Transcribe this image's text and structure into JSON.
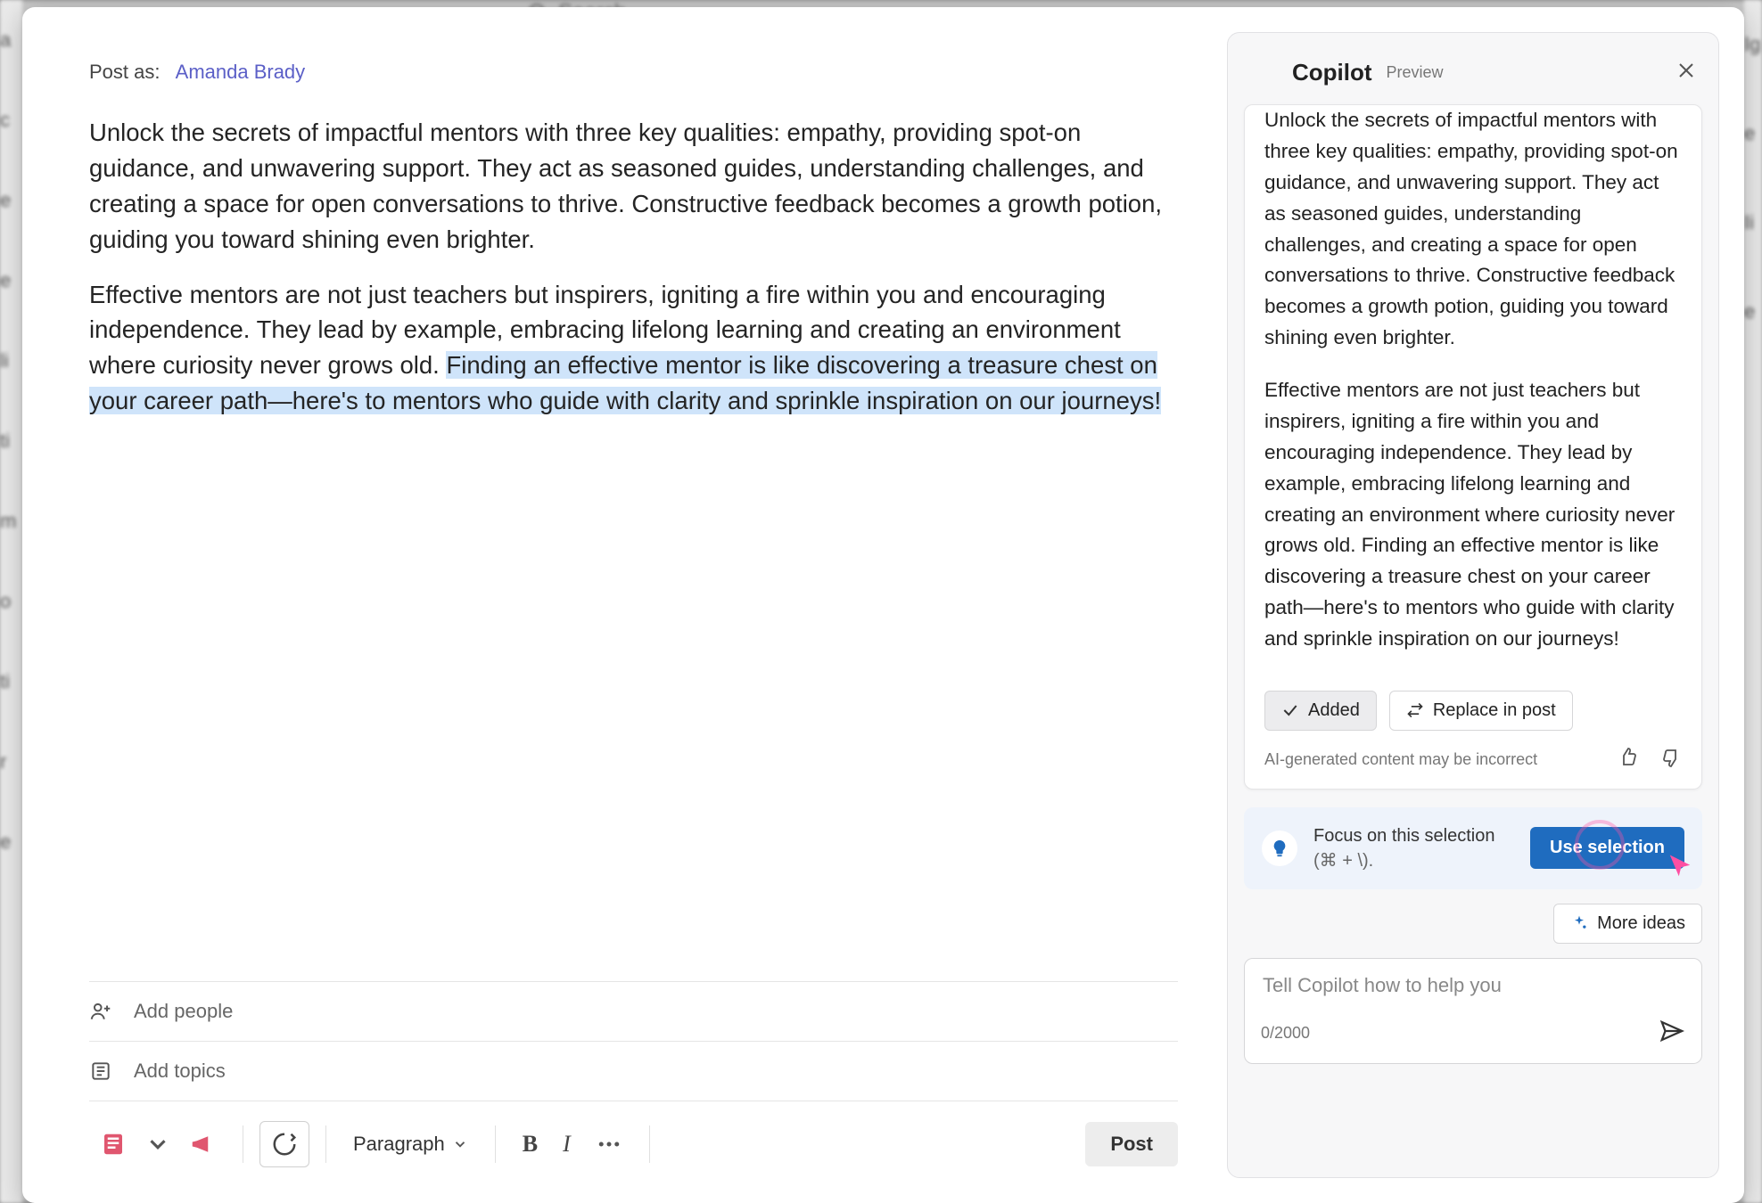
{
  "bg": {
    "search_placeholder": "Search",
    "left_snips": [
      "a",
      "c",
      "e",
      "e",
      "li",
      "ti",
      "m",
      "o",
      "ti",
      "",
      "r",
      "e"
    ],
    "right_snips": [
      "",
      "Ig",
      "",
      "",
      "e",
      "",
      "Ii",
      "",
      "",
      "e"
    ]
  },
  "post": {
    "postas_label": "Post as:",
    "author": "Amanda Brady",
    "para1": "Unlock the secrets of impactful mentors with three key qualities: empathy, providing spot-on guidance, and unwavering support. They act as seasoned guides, understanding challenges, and creating a space for open conversations to thrive. Constructive feedback becomes a growth potion, guiding you toward shining even brighter.",
    "para2_plain": "Effective mentors are not just teachers but inspirers, igniting a fire within you and encouraging independence. They lead by example, embracing lifelong learning and creating an environment where curiosity never grows old. ",
    "para2_highlight": "Finding an effective mentor is like discovering a treasure chest on your career path—here's to mentors who guide with clarity and sprinkle inspiration on our journeys!",
    "add_people": "Add people",
    "add_topics": "Add topics",
    "paragraph_label": "Paragraph",
    "post_button": "Post"
  },
  "copilot": {
    "title": "Copilot",
    "badge": "Preview",
    "resp_p1": "Unlock the secrets of impactful mentors with three key qualities: empathy, providing spot-on guidance, and unwavering support. They act as seasoned guides, understanding challenges, and creating a space for open conversations to thrive. Constructive feedback becomes a growth potion, guiding you toward shining even brighter.",
    "resp_p2": "Effective mentors are not just teachers but inspirers, igniting a fire within you and encouraging independence. They lead by example, embracing lifelong learning and creating an environment where curiosity never grows old. Finding an effective mentor is like discovering a treasure chest on your career path—here's to mentors who guide with clarity and sprinkle inspiration on our journeys!",
    "added_label": "Added",
    "replace_label": "Replace in post",
    "disclaimer": "AI-generated content may be incorrect",
    "focus_title": "Focus on this selection",
    "focus_sub": "(⌘ + \\).",
    "focus_button": "Use selection",
    "more_ideas": "More ideas",
    "prompt_placeholder": "Tell Copilot how to help you",
    "char_counter": "0/2000"
  }
}
